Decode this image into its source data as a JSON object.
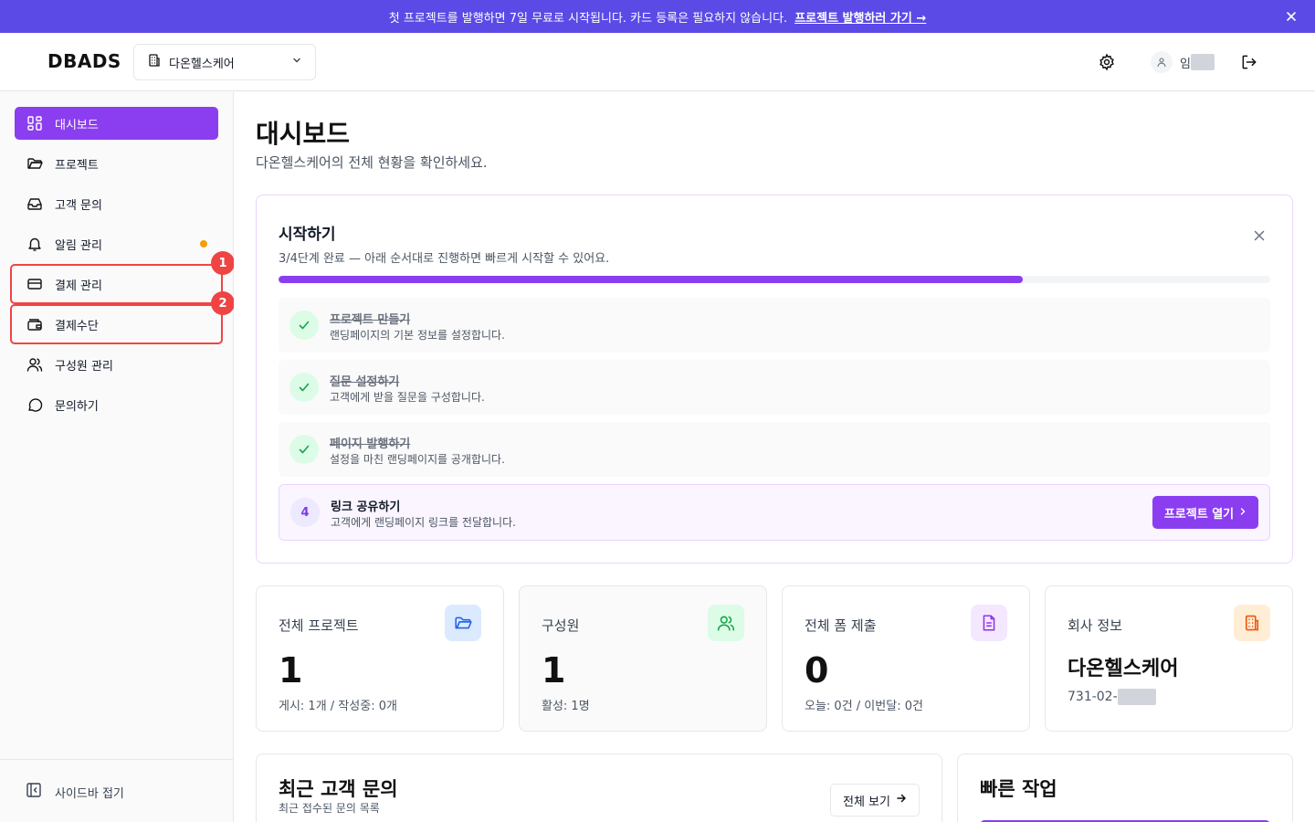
{
  "banner": {
    "text": "첫 프로젝트를 발행하면 7일 무료로 시작됩니다. 카드 등록은 필요하지 않습니다.",
    "link": "프로젝트 발행하러 가기 →"
  },
  "header": {
    "logo": "DBADS",
    "org": "다온헬스케어",
    "user_initial": "임"
  },
  "sidebar": {
    "items": [
      {
        "label": "대시보드",
        "icon": "grid-icon"
      },
      {
        "label": "프로젝트",
        "icon": "folder-icon"
      },
      {
        "label": "고객 문의",
        "icon": "inbox-icon"
      },
      {
        "label": "알림 관리",
        "icon": "bell-icon"
      },
      {
        "label": "결제 관리",
        "icon": "credit-card-icon"
      },
      {
        "label": "결제수단",
        "icon": "wallet-icon"
      },
      {
        "label": "구성원 관리",
        "icon": "users-icon"
      },
      {
        "label": "문의하기",
        "icon": "chat-icon"
      }
    ],
    "annotations": [
      "1",
      "2"
    ],
    "collapse": "사이드바 접기"
  },
  "main": {
    "title": "대시보드",
    "subtitle": "다온헬스케어의 전체 현황을 확인하세요.",
    "onboarding": {
      "title": "시작하기",
      "desc": "3/4단계 완료 — 아래 순서대로 진행하면 빠르게 시작할 수 있어요.",
      "progress": 0.75,
      "steps": [
        {
          "title": "프로젝트 만들기",
          "desc": "랜딩페이지의 기본 정보를 설정합니다."
        },
        {
          "title": "질문 설정하기",
          "desc": "고객에게 받을 질문을 구성합니다."
        },
        {
          "title": "페이지 발행하기",
          "desc": "설정을 마친 랜딩페이지를 공개합니다."
        },
        {
          "number": "4",
          "title": "링크 공유하기",
          "desc": "고객에게 랜딩페이지 링크를 전달합니다."
        }
      ],
      "button": "프로젝트 열기"
    },
    "cards": [
      {
        "label": "전체 프로젝트",
        "value": "1",
        "sub": "게시: 1개 / 작성중: 0개"
      },
      {
        "label": "구성원",
        "value": "1",
        "sub": "활성: 1명"
      },
      {
        "label": "전체 폼 제출",
        "value": "0",
        "sub": "오늘: 0건 / 이번달: 0건"
      },
      {
        "label": "회사 정보",
        "name": "다온헬스케어",
        "biz_prefix": "731-02-"
      }
    ],
    "recent": {
      "title": "최근 고객 문의",
      "sub": "최근 접수된 문의 목록",
      "button": "전체 보기"
    },
    "quick": {
      "title": "빠른 작업"
    }
  },
  "colors": {
    "accent": "#8b3ef0",
    "banner": "#5b4ae6",
    "highlight": "#ef4444"
  }
}
